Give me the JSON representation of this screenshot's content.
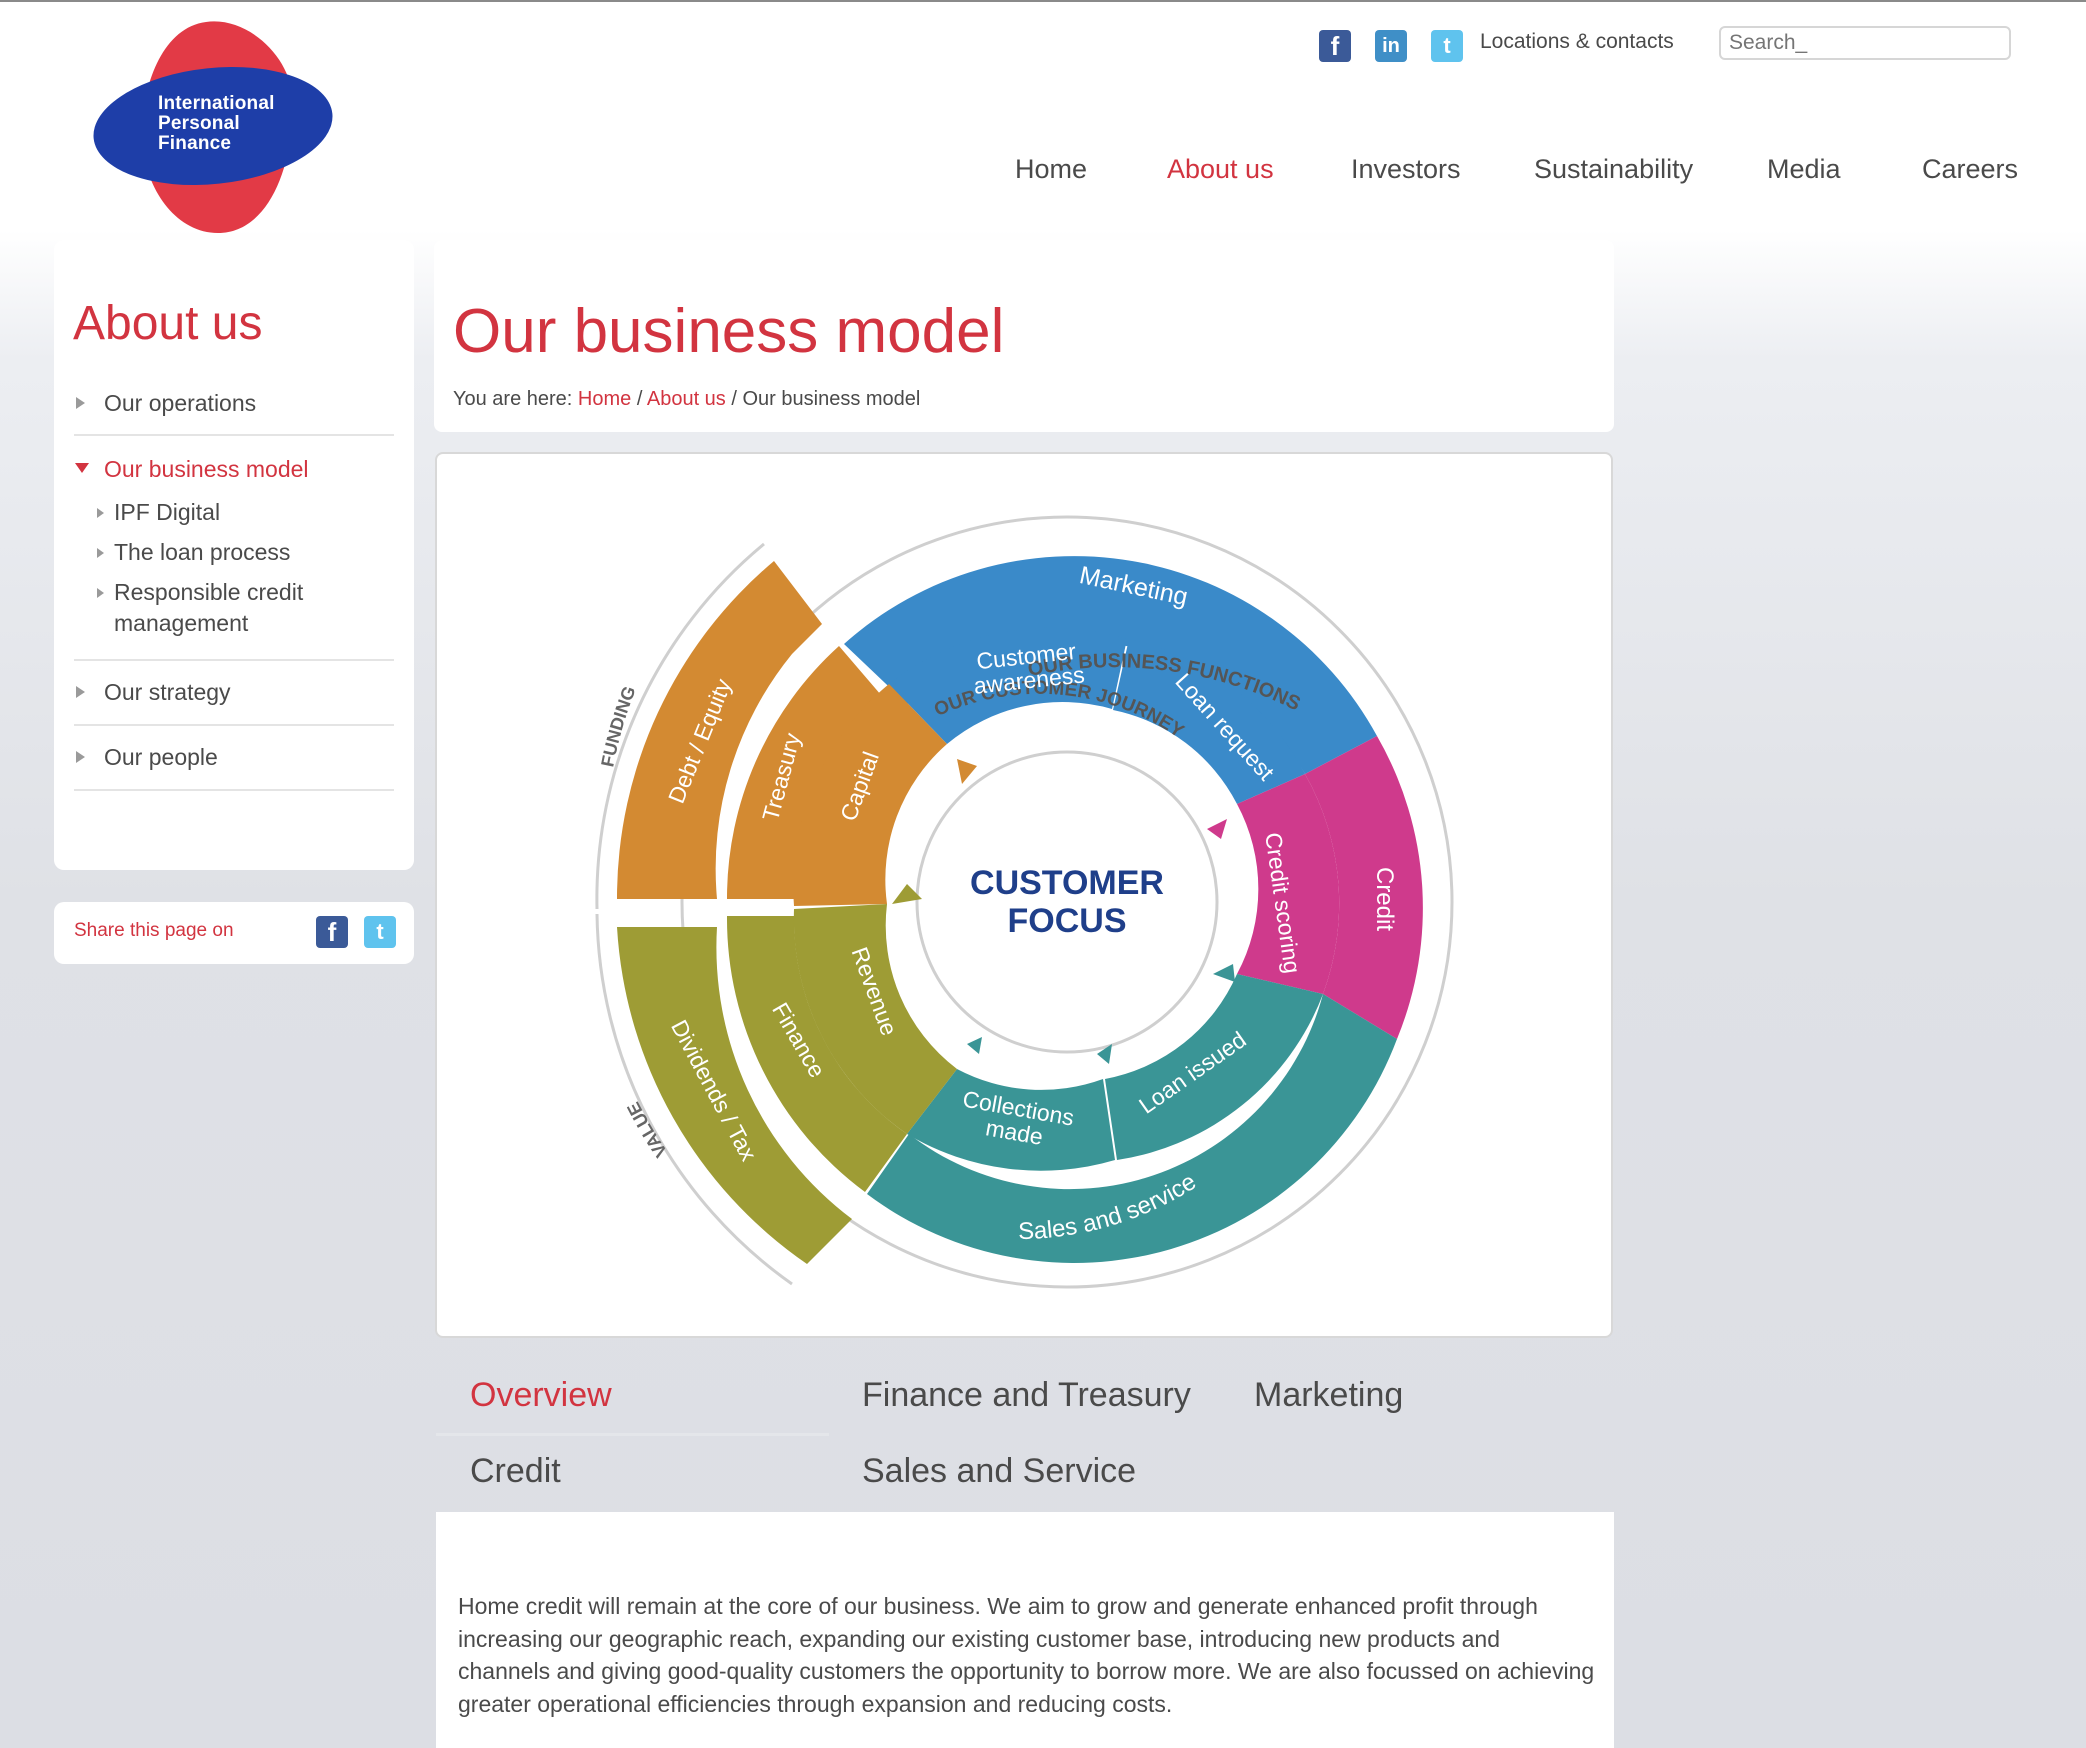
{
  "brand": {
    "logo_lines": [
      "International",
      "Personal",
      "Finance"
    ],
    "colors": {
      "brand_red": "#d23440",
      "brand_blue": "#1e3ea8"
    }
  },
  "utility": {
    "social_icons": [
      "facebook-icon",
      "linkedin-icon",
      "twitter-icon"
    ],
    "locations_link": "Locations & contacts",
    "search_placeholder": "Search_"
  },
  "nav": {
    "items": [
      {
        "label": "Home",
        "active": false
      },
      {
        "label": "About us",
        "active": true
      },
      {
        "label": "Investors",
        "active": false
      },
      {
        "label": "Sustainability",
        "active": false
      },
      {
        "label": "Media",
        "active": false
      },
      {
        "label": "Careers",
        "active": false
      }
    ]
  },
  "sidebar": {
    "title": "About us",
    "items": [
      {
        "label": "Our operations"
      },
      {
        "label": "Our business model",
        "active": true
      },
      {
        "label": "Our strategy"
      },
      {
        "label": "Our people"
      }
    ],
    "subitems": [
      {
        "label": "IPF Digital"
      },
      {
        "label": "The loan process"
      },
      {
        "label": "Responsible credit management"
      }
    ],
    "share_label": "Share this page on"
  },
  "page": {
    "title": "Our business model",
    "breadcrumb": {
      "prefix": "You are here:",
      "home": "Home",
      "about": "About us",
      "current": "Our business model",
      "separator": "/"
    }
  },
  "diagram": {
    "center_line1": "CUSTOMER",
    "center_line2": "FOCUS",
    "outer_label": "OUR BUSINESS FUNCTIONS",
    "inner_label": "OUR CUSTOMER JOURNEY",
    "funding_label": "FUNDING",
    "value_label": "VALUE",
    "segments": {
      "marketing": "Marketing",
      "customer_awareness_1": "Customer",
      "customer_awareness_2": "awareness",
      "loan_request": "Loan request",
      "credit": "Credit",
      "credit_scoring": "Credit scoring",
      "sales_and_service": "Sales and service",
      "loan_issued": "Loan issued",
      "collections_1": "Collections",
      "collections_2": "made",
      "revenue": "Revenue",
      "finance": "Finance",
      "dividends": "Dividends / Tax",
      "capital": "Capital",
      "treasury": "Treasury",
      "debt_equity": "Debt / Equity"
    },
    "colors": {
      "blue": "#3a8ac9",
      "magenta": "#cf3a8c",
      "teal": "#3a9596",
      "olive": "#9e9c35",
      "orange": "#d38a32",
      "navy": "#1f3f8a"
    }
  },
  "tabs": {
    "items": [
      {
        "label": "Overview",
        "active": true
      },
      {
        "label": "Finance and Treasury"
      },
      {
        "label": "Marketing"
      },
      {
        "label": "Credit"
      },
      {
        "label": "Sales and Service"
      }
    ]
  },
  "content": {
    "paragraph": "Home credit will remain at the core of our business. We aim to grow and generate enhanced profit through increasing our geographic reach, expanding our existing customer base, introducing new products and channels and giving good-quality customers the opportunity to borrow more. We are also focussed on achieving greater operational efficiencies through expansion and reducing costs."
  }
}
